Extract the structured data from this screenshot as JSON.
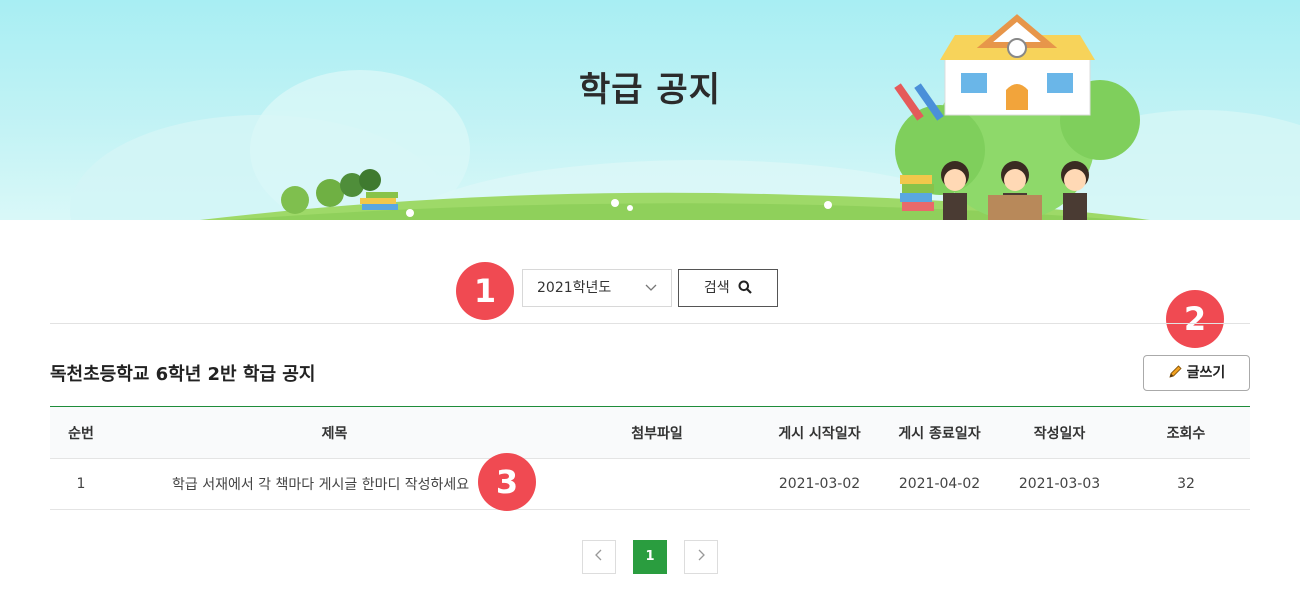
{
  "banner": {
    "title": "학급 공지"
  },
  "search": {
    "badge": "1",
    "year_value": "2021학년도",
    "button_label": "검색"
  },
  "write": {
    "badge": "2",
    "button_label": "글쓰기"
  },
  "board": {
    "title": "독천초등학교 6학년 2반 학급 공지"
  },
  "table": {
    "headers": [
      "순번",
      "제목",
      "첨부파일",
      "게시 시작일자",
      "게시 종료일자",
      "작성일자",
      "조회수"
    ],
    "rows": [
      {
        "no": "1",
        "title": "학급 서재에서 각 책마다 게시글 한마디 작성하세요",
        "attach": "",
        "start": "2021-03-02",
        "end": "2021-04-02",
        "created": "2021-03-03",
        "views": "32"
      }
    ],
    "row_badge": "3"
  },
  "pagination": {
    "current": "1"
  },
  "colors": {
    "accent_green": "#2a9d3f",
    "badge_red": "#f04a52",
    "header_line": "#1e8c3a"
  }
}
